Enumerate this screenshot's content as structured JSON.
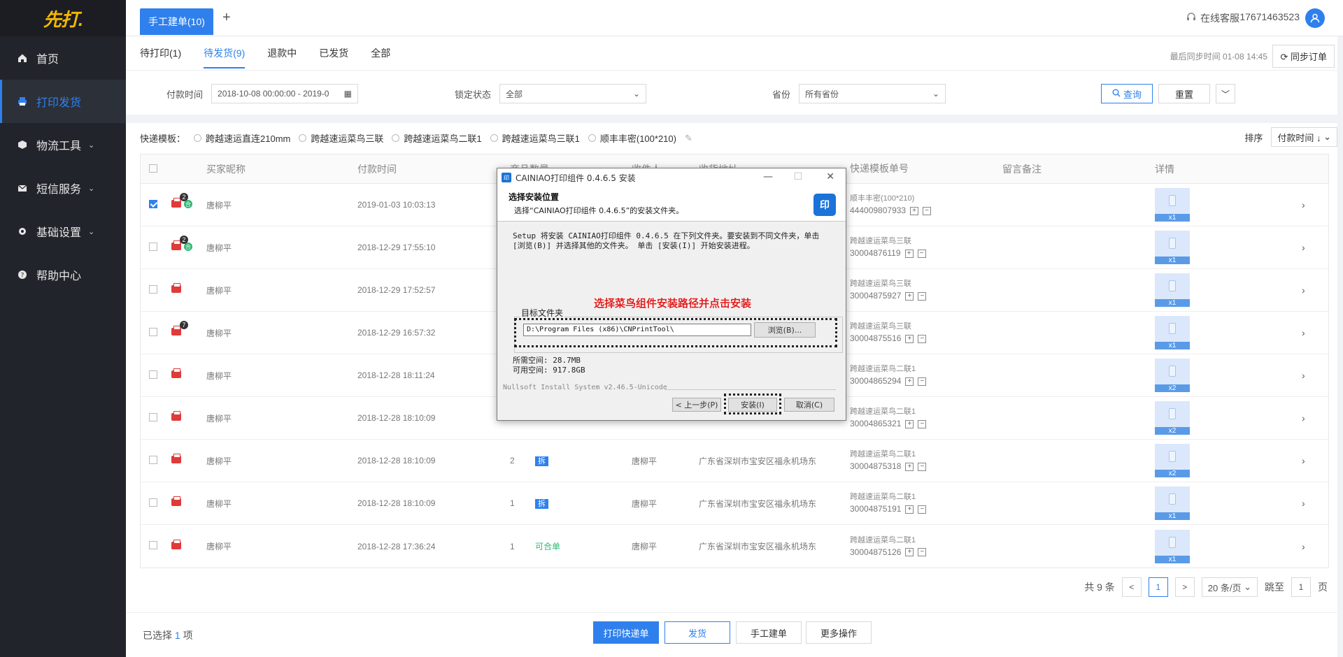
{
  "sidebar": {
    "logo": "先打.",
    "items": [
      {
        "label": "首页",
        "icon": "home-icon",
        "active": false,
        "has_children": false
      },
      {
        "label": "打印发货",
        "icon": "printer-icon",
        "active": true,
        "has_children": false
      },
      {
        "label": "物流工具",
        "icon": "box-icon",
        "active": false,
        "has_children": true
      },
      {
        "label": "短信服务",
        "icon": "mail-icon",
        "active": false,
        "has_children": true
      },
      {
        "label": "基础设置",
        "icon": "gear-icon",
        "active": false,
        "has_children": true
      },
      {
        "label": "帮助中心",
        "icon": "help-icon",
        "active": false,
        "has_children": false
      }
    ]
  },
  "topbar": {
    "tab_label": "手工建单(10)",
    "service_label": "在线客服",
    "phone": "17671463523",
    "avatar_icon": "user-icon"
  },
  "subtabs": [
    "待打印(1)",
    "待发货(9)",
    "退款中",
    "已发货",
    "全部"
  ],
  "active_subtab": 1,
  "sync": {
    "time": "最后同步时间 01-08 14:45",
    "button": "同步订单"
  },
  "filters": {
    "pay_time_label": "付款时间",
    "pay_time_value": "2018-10-08 00:00:00 - 2019-0",
    "lock_label": "锁定状态",
    "lock_value": "全部",
    "province_label": "省份",
    "province_value": "所有省份",
    "query_button": "查询",
    "reset_button": "重置"
  },
  "templates": {
    "label": "快递模板：",
    "options": [
      "跨越速运直连210mm",
      "跨越速运菜鸟三联",
      "跨越速运菜鸟二联1",
      "跨越速运菜鸟三联1",
      "顺丰丰密(100*210)"
    ]
  },
  "sort": {
    "label": "排序",
    "value": "付款时间 ↓"
  },
  "table": {
    "headers": {
      "buyer": "买家昵称",
      "time": "付款时间",
      "qty": "商品数量",
      "receiver": "收件人",
      "address": "收货地址",
      "template": "快递模板单号",
      "note": "留言备注",
      "detail": "详情"
    },
    "rows": [
      {
        "checked": true,
        "badge": "2",
        "green": true,
        "buyer": "唐柳平",
        "time": "2019-01-03 10:03:13",
        "qty": "",
        "tag": "",
        "receiver": "",
        "address": "",
        "tpl": "顺丰丰密(100*210)",
        "num": "444009807933",
        "count": "x1"
      },
      {
        "checked": false,
        "badge": "2",
        "green": true,
        "buyer": "唐柳平",
        "time": "2018-12-29 17:55:10",
        "qty": "",
        "tag": "",
        "receiver": "",
        "address": "",
        "tpl": "跨越速运菜鸟三联",
        "num": "30004876119",
        "count": "x1"
      },
      {
        "checked": false,
        "badge": "",
        "green": false,
        "buyer": "唐柳平",
        "time": "2018-12-29 17:52:57",
        "qty": "",
        "tag": "",
        "receiver": "",
        "address": "",
        "tpl": "跨越速运菜鸟三联",
        "num": "30004875927",
        "count": "x1"
      },
      {
        "checked": false,
        "badge": "7",
        "green": false,
        "buyer": "唐柳平",
        "time": "2018-12-29 16:57:32",
        "qty": "",
        "tag": "",
        "receiver": "",
        "address": "",
        "tpl": "跨越速运菜鸟三联",
        "num": "30004875516",
        "count": "x1"
      },
      {
        "checked": false,
        "badge": "",
        "green": false,
        "buyer": "唐柳平",
        "time": "2018-12-28 18:11:24",
        "qty": "",
        "tag": "",
        "receiver": "",
        "address": "",
        "tpl": "跨越速运菜鸟二联1",
        "num": "30004865294",
        "count": "x2"
      },
      {
        "checked": false,
        "badge": "",
        "green": false,
        "buyer": "唐柳平",
        "time": "2018-12-28 18:10:09",
        "qty": "",
        "tag": "",
        "receiver": "",
        "address": "",
        "tpl": "跨越速运菜鸟二联1",
        "num": "30004865321",
        "count": "x2"
      },
      {
        "checked": false,
        "badge": "",
        "green": false,
        "buyer": "唐柳平",
        "time": "2018-12-28 18:10:09",
        "qty": "2",
        "tag": "拆",
        "receiver": "唐柳平",
        "address": "广东省深圳市宝安区福永机场东",
        "tpl": "跨越速运菜鸟二联1",
        "num": "30004875318",
        "count": "x2"
      },
      {
        "checked": false,
        "badge": "",
        "green": false,
        "buyer": "唐柳平",
        "time": "2018-12-28 18:10:09",
        "qty": "1",
        "tag": "拆",
        "receiver": "唐柳平",
        "address": "广东省深圳市宝安区福永机场东",
        "tpl": "跨越速运菜鸟二联1",
        "num": "30004875191",
        "count": "x1"
      },
      {
        "checked": false,
        "badge": "",
        "green": false,
        "buyer": "唐柳平",
        "time": "2018-12-28 17:36:24",
        "qty": "1",
        "tag": "可合单",
        "receiver": "唐柳平",
        "address": "广东省深圳市宝安区福永机场东",
        "tpl": "跨越速运菜鸟二联1",
        "num": "30004875126",
        "count": "x1"
      }
    ]
  },
  "pagination": {
    "total": "共 9 条",
    "current": "1",
    "page_size": "20 条/页",
    "jump_label": "跳至",
    "jump_value": "1",
    "page_unit": "页"
  },
  "footer": {
    "selected_prefix": "已选择",
    "selected_count": "1",
    "selected_suffix": "项",
    "buttons": [
      "打印快递单",
      "发货",
      "手工建单",
      "更多操作"
    ]
  },
  "dialog": {
    "title": "CAINIAO打印组件 0.4.6.5 安装",
    "heading": "选择安装位置",
    "subheading": "选择“CAINIAO打印组件 0.4.6.5”的安装文件夹。",
    "body_line1": "Setup 将安装 CAINIAO打印组件 0.4.6.5 在下列文件夹。要安装到不同文件夹，单击",
    "body_line2": "[浏览(B)] 并选择其他的文件夹。 单击 [安装(I)] 开始安装进程。",
    "hint": "选择菜鸟组件安装路径并点击安装",
    "group_label": "目标文件夹",
    "path": "D:\\Program Files (x86)\\CNPrintTool\\",
    "browse": "浏览(B)...",
    "space_required": "所需空间: 28.7MB",
    "space_available": "可用空间: 917.8GB",
    "nsis": "Nullsoft Install System v2.46.5-Unicode",
    "back": "< 上一步(P)",
    "install": "安装(I)",
    "cancel": "取消(C)"
  },
  "colors": {
    "accent": "#2f80ed",
    "sidebar": "#22242b",
    "logo": "#f5b800",
    "danger": "#e03a3a",
    "success": "#2fb872",
    "hint": "#e02020"
  }
}
